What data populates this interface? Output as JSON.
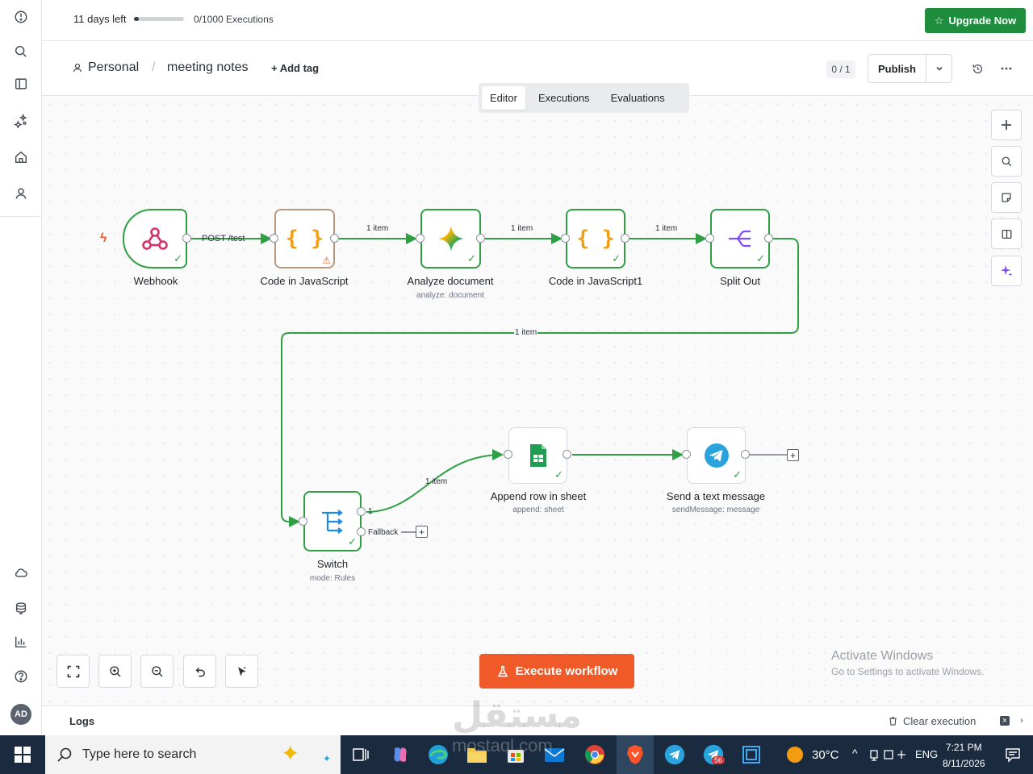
{
  "rail": {
    "top_icons": [
      "overview-icon",
      "search-icon",
      "panel-icon",
      "ai-sparkle-icon",
      "home-icon",
      "user-icon"
    ],
    "bottom_icons": [
      "cloud-icon",
      "database-icon",
      "insights-icon",
      "help-icon"
    ],
    "avatar_initials": "AD"
  },
  "banner": {
    "days_left": "11 days left",
    "executions": "0/1000 Executions",
    "executions_progress": 0.0,
    "upgrade_label": "Upgrade Now"
  },
  "header": {
    "project": "Personal",
    "workflow_name": "meeting notes",
    "add_tag": "+ Add tag",
    "version": "0 / 1",
    "publish_label": "Publish"
  },
  "tabs": [
    {
      "label": "Editor",
      "active": true
    },
    {
      "label": "Executions",
      "active": false
    },
    {
      "label": "Evaluations",
      "active": false
    }
  ],
  "nodes": {
    "webhook": {
      "label": "Webhook"
    },
    "code1": {
      "label": "Code in JavaScript"
    },
    "analyze": {
      "label": "Analyze document",
      "sub": "analyze: document"
    },
    "code2": {
      "label": "Code in JavaScript1"
    },
    "split": {
      "label": "Split Out"
    },
    "switch": {
      "label": "Switch",
      "sub": "mode: Rules"
    },
    "append": {
      "label": "Append row in sheet",
      "sub": "append: sheet"
    },
    "telegram": {
      "label": "Send a text message",
      "sub": "sendMessage: message"
    }
  },
  "edges": {
    "webhook_out": "POST /test",
    "e1": "1 item",
    "e2": "1 item",
    "e3": "1 item",
    "e4": "1 item",
    "e5": "1 item",
    "switch_out1": "1",
    "switch_fallback": "Fallback"
  },
  "canvas_tools": [
    "zoom-in-icon",
    "search-icon",
    "sticky-note-icon",
    "panel-icon",
    "ai-sparkle-icon"
  ],
  "bottom": {
    "execute_label": "Execute workflow",
    "activate_title": "Activate Windows",
    "activate_sub": "Go to Settings to activate Windows."
  },
  "logs": {
    "title": "Logs",
    "clear_label": "Clear execution"
  },
  "taskbar": {
    "search_placeholder": "Type here to search",
    "temperature": "30°C",
    "language": "ENG",
    "time": "7:21 PM",
    "date": "8/11/2026",
    "badge": "56"
  },
  "watermark": {
    "text": "مستقل",
    "sub": "mostaql.com"
  },
  "colors": {
    "accent_green": "#2ea043",
    "upgrade_green": "#1e8e3e",
    "execute_orange": "#f05a28",
    "taskbar": "#1b2b3f"
  }
}
